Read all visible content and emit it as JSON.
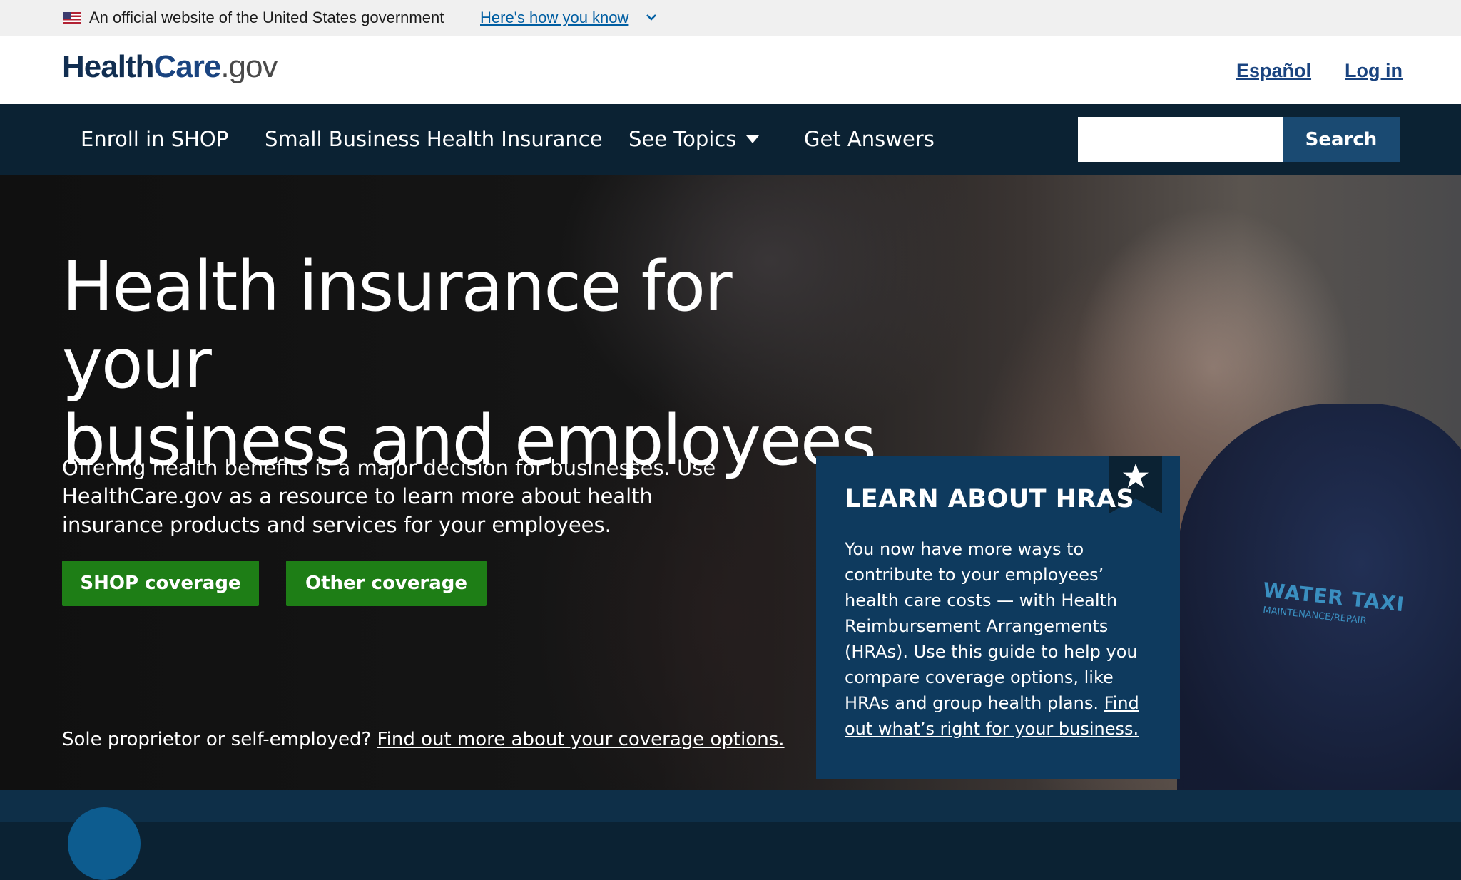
{
  "gov_banner": {
    "text": "An official website of the United States government",
    "link": "Here's how you know"
  },
  "header": {
    "logo_health": "Health",
    "logo_care": "Care",
    "logo_gov": ".gov",
    "espanol": "Español",
    "login": "Log in"
  },
  "nav": {
    "items": [
      "Enroll in SHOP",
      "Small Business Health Insurance",
      "See Topics",
      "Get Answers"
    ],
    "search_label": "Search",
    "search_placeholder": ""
  },
  "hero": {
    "title_line1": "Health insurance for your",
    "title_line2": "business and employees",
    "text": "Offering health benefits is a major decision for businesses. Use HealthCare.gov as a resource to learn more about health insurance products and services for your employees.",
    "shop_button": "SHOP coverage",
    "other_button": "Other coverage",
    "sole_text": "Sole proprietor or self-employed?",
    "sole_link": "Find out more about your coverage options.",
    "photo_shirt_text": "WATER TAXI",
    "photo_shirt_sub": "MAINTENANCE/REPAIR"
  },
  "hra": {
    "title": "LEARN ABOUT HRAS",
    "body": "You now have more ways to contribute to your employees’ health care costs — with Health Reimbursement Arrangements (HRAs). Use this guide to help you compare coverage options, like HRAs and group health plans.",
    "link": "Find out what’s right for your business."
  },
  "colors": {
    "nav_bg": "#0b2233",
    "brand_blue": "#1a4480",
    "cta_green": "#1e7e16",
    "card_bg": "#0e3a5e"
  }
}
